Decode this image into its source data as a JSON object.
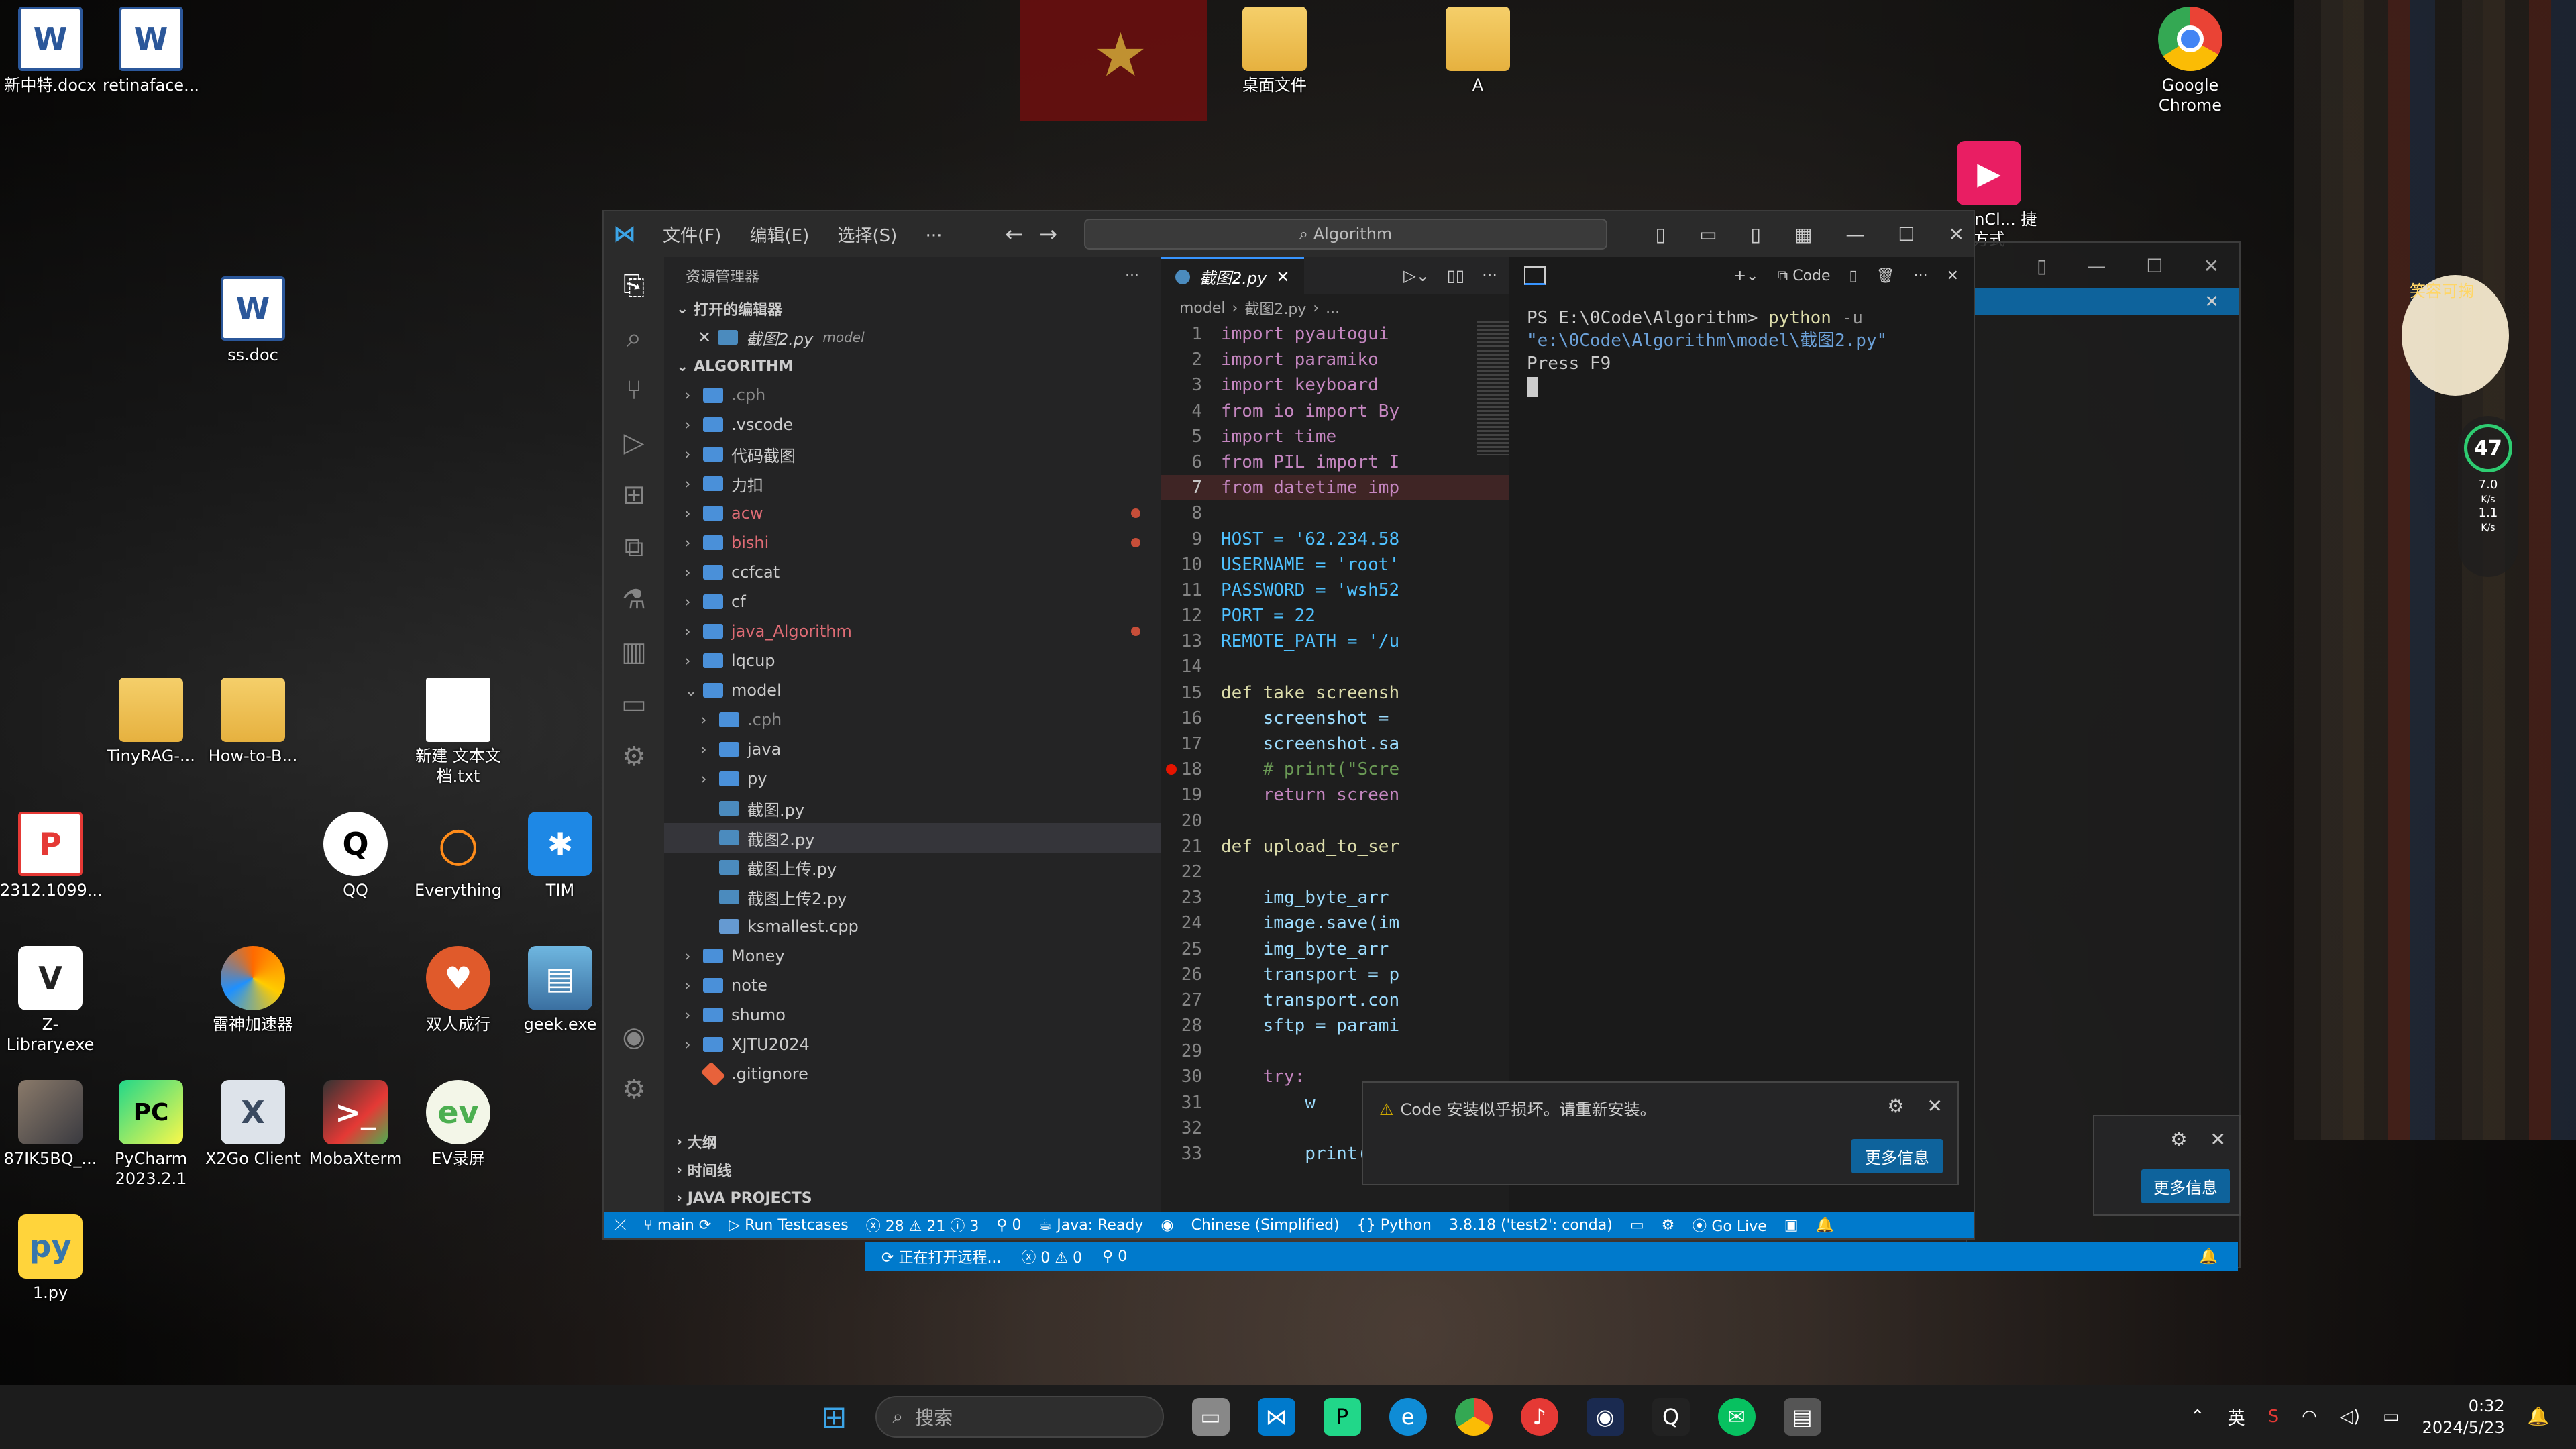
{
  "desktop": {
    "icons": [
      {
        "label": "新中特.docx",
        "type": "word",
        "icon": "word-doc-icon"
      },
      {
        "label": "retinaface...",
        "type": "word",
        "icon": "word-doc-icon"
      },
      {
        "label": "桌面文件",
        "type": "folder",
        "icon": "folder-icon"
      },
      {
        "label": "A",
        "type": "folder",
        "icon": "folder-icon"
      },
      {
        "label": "Google Chrome",
        "type": "app",
        "icon": "chrome-icon"
      },
      {
        "label": "ss.doc",
        "type": "word",
        "icon": "word-doc-icon"
      },
      {
        "label": "TinyRAG-...",
        "type": "folder",
        "icon": "folder-icon"
      },
      {
        "label": "How-to-B...",
        "type": "folder",
        "icon": "folder-icon"
      },
      {
        "label": "新建 文本文档.txt",
        "type": "txt",
        "icon": "text-file-icon"
      },
      {
        "label": "2312.1099...",
        "type": "pdf",
        "icon": "pdf-icon"
      },
      {
        "label": "QQ",
        "type": "app",
        "icon": "qq-icon"
      },
      {
        "label": "Everything",
        "type": "app",
        "icon": "everything-icon"
      },
      {
        "label": "TIM",
        "type": "app",
        "icon": "tim-icon"
      },
      {
        "label": "Z-Library.exe",
        "type": "app",
        "icon": "zlibrary-icon"
      },
      {
        "label": "雷神加速器",
        "type": "app",
        "icon": "leishen-icon"
      },
      {
        "label": "双人成行",
        "type": "app",
        "icon": "game-icon"
      },
      {
        "label": "geek.exe",
        "type": "app",
        "icon": "geek-icon"
      },
      {
        "label": "87IK5BQ_...",
        "type": "image",
        "icon": "image-icon"
      },
      {
        "label": "PyCharm 2023.2.1",
        "type": "app",
        "icon": "pycharm-icon"
      },
      {
        "label": "X2Go Client",
        "type": "app",
        "icon": "x2go-icon"
      },
      {
        "label": "MobaXterm",
        "type": "app",
        "icon": "mobaxterm-icon"
      },
      {
        "label": "EV录屏",
        "type": "app",
        "icon": "ev-icon"
      },
      {
        "label": "1.py",
        "type": "py",
        "icon": "python-file-icon"
      },
      {
        "label": "LoginCl... 捷方式",
        "type": "app",
        "icon": "login-icon"
      }
    ]
  },
  "vscode": {
    "menu": [
      "文件(F)",
      "编辑(E)",
      "选择(S)",
      "···"
    ],
    "search": "Algorithm",
    "explorer": {
      "title": "资源管理器",
      "open_editors": "打开的编辑器",
      "open_file": "截图2.py",
      "open_file_dir": "model",
      "root": "ALGORITHM",
      "tree": [
        {
          "label": ".cph",
          "kind": "folder",
          "indent": 0,
          "dim": true
        },
        {
          "label": ".vscode",
          "kind": "folder",
          "indent": 0
        },
        {
          "label": "代码截图",
          "kind": "folder",
          "indent": 0
        },
        {
          "label": "力扣",
          "kind": "folder",
          "indent": 0
        },
        {
          "label": "acw",
          "kind": "folder",
          "indent": 0,
          "err": true
        },
        {
          "label": "bishi",
          "kind": "folder",
          "indent": 0,
          "err": true
        },
        {
          "label": "ccfcat",
          "kind": "folder",
          "indent": 0
        },
        {
          "label": "cf",
          "kind": "folder",
          "indent": 0
        },
        {
          "label": "java_Algorithm",
          "kind": "folder",
          "indent": 0,
          "err": true
        },
        {
          "label": "lqcup",
          "kind": "folder",
          "indent": 0
        },
        {
          "label": "model",
          "kind": "folder-open",
          "indent": 0
        },
        {
          "label": ".cph",
          "kind": "folder",
          "indent": 1,
          "dim": true
        },
        {
          "label": "java",
          "kind": "folder",
          "indent": 1
        },
        {
          "label": "py",
          "kind": "folder",
          "indent": 1
        },
        {
          "label": "截图.py",
          "kind": "py",
          "indent": 1
        },
        {
          "label": "截图2.py",
          "kind": "py",
          "indent": 1,
          "selected": true
        },
        {
          "label": "截图上传.py",
          "kind": "py",
          "indent": 1
        },
        {
          "label": "截图上传2.py",
          "kind": "py",
          "indent": 1
        },
        {
          "label": "ksmallest.cpp",
          "kind": "cpp",
          "indent": 1
        },
        {
          "label": "Money",
          "kind": "folder",
          "indent": 0
        },
        {
          "label": "note",
          "kind": "folder",
          "indent": 0
        },
        {
          "label": "shumo",
          "kind": "folder",
          "indent": 0
        },
        {
          "label": "XJTU2024",
          "kind": "folder",
          "indent": 0
        },
        {
          "label": ".gitignore",
          "kind": "git",
          "indent": 0
        }
      ],
      "outline": "大纲",
      "timeline": "时间线",
      "java_projects": "JAVA PROJECTS"
    },
    "editor": {
      "tab": "截图2.py",
      "breadcrumb": [
        "model",
        "截图2.py",
        "..."
      ],
      "lines": [
        {
          "n": "1",
          "t": "import pyautogui"
        },
        {
          "n": "2",
          "t": "import paramiko"
        },
        {
          "n": "3",
          "t": "import keyboard"
        },
        {
          "n": "4",
          "t": "from io import By"
        },
        {
          "n": "5",
          "t": "import time"
        },
        {
          "n": "6",
          "t": "from PIL import I"
        },
        {
          "n": "7",
          "t": "from datetime imp"
        },
        {
          "n": "8",
          "t": ""
        },
        {
          "n": "9",
          "t": "HOST = '62.234.58"
        },
        {
          "n": "10",
          "t": "USERNAME = 'root'"
        },
        {
          "n": "11",
          "t": "PASSWORD = 'wsh52"
        },
        {
          "n": "12",
          "t": "PORT = 22"
        },
        {
          "n": "13",
          "t": "REMOTE_PATH = '/u"
        },
        {
          "n": "14",
          "t": ""
        },
        {
          "n": "15",
          "t": "def take_screensh"
        },
        {
          "n": "16",
          "t": "    screenshot = "
        },
        {
          "n": "17",
          "t": "    screenshot.sa"
        },
        {
          "n": "18",
          "t": "    # print(\"Scre"
        },
        {
          "n": "19",
          "t": "    return screen"
        },
        {
          "n": "20",
          "t": ""
        },
        {
          "n": "21",
          "t": "def upload_to_ser"
        },
        {
          "n": "22",
          "t": ""
        },
        {
          "n": "23",
          "t": "    img_byte_arr "
        },
        {
          "n": "24",
          "t": "    image.save(im"
        },
        {
          "n": "25",
          "t": "    img_byte_arr "
        },
        {
          "n": "26",
          "t": "    transport = p"
        },
        {
          "n": "27",
          "t": "    transport.con"
        },
        {
          "n": "28",
          "t": "    sftp = parami"
        },
        {
          "n": "29",
          "t": ""
        },
        {
          "n": "30",
          "t": "    try:"
        },
        {
          "n": "31",
          "t": "        w"
        },
        {
          "n": "32",
          "t": ""
        },
        {
          "n": "33",
          "t": "        print(f's"
        }
      ]
    },
    "terminal": {
      "code_label": "Code",
      "prompt": "PS E:\\0Code\\Algorithm>",
      "command": "python",
      "flag": "-u",
      "path": "\"e:\\0Code\\Algorithm\\model\\截图2.py\"",
      "output": "Press F9"
    },
    "notification": {
      "message": "Code 安装似乎损坏。请重新安装。",
      "button": "更多信息"
    },
    "notification2": {
      "button": "更多信息"
    },
    "status": {
      "branch": "main",
      "run": "Run Testcases",
      "errors": "28",
      "warnings": "21",
      "info": "3",
      "ports": "0",
      "java": "Java: Ready",
      "lang": "Chinese (Simplified)",
      "python": "Python",
      "interpreter": "3.8.18 ('test2': conda)",
      "golive": "Go Live"
    },
    "status2": {
      "remote": "正在打开远程...",
      "errs": "0",
      "warns": "0",
      "ports": "0"
    }
  },
  "widget": {
    "percent": "47",
    "up": "7.0",
    "up_unit": "K/s",
    "down": "1.1",
    "down_unit": "K/s",
    "mascot_label": "笑容可掬"
  },
  "taskbar": {
    "search_placeholder": "搜索",
    "ime": "英",
    "time": "0:32",
    "date": "2024/5/23"
  }
}
